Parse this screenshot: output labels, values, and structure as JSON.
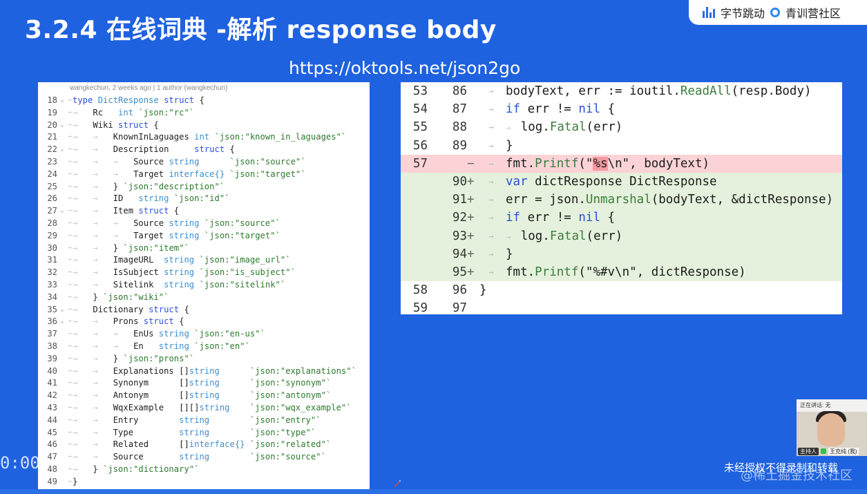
{
  "slide": {
    "title": "3.2.4 在线词典 -解析 response body",
    "url": "https://oktools.net/json2go"
  },
  "branding": {
    "logo1": "字节跳动",
    "logo2": "青训营社区"
  },
  "left_code": {
    "blame": "wangkechun, 2 weeks ago | 1 author (wangkechun)",
    "lines": [
      {
        "n": "18",
        "fold": "⌄",
        "indent": 0,
        "parts": [
          [
            "kw",
            "type "
          ],
          [
            "typ",
            "DictResponse "
          ],
          [
            "kw",
            "struct "
          ],
          [
            "",
            "{"
          ]
        ]
      },
      {
        "n": "19",
        "fold": "",
        "indent": 1,
        "parts": [
          [
            "",
            "Rc   "
          ],
          [
            "typ",
            "int "
          ],
          [
            "tag",
            "`json:\"rc\"`"
          ]
        ]
      },
      {
        "n": "20",
        "fold": "⌄",
        "indent": 1,
        "parts": [
          [
            "",
            "Wiki "
          ],
          [
            "kw",
            "struct "
          ],
          [
            "",
            "{"
          ]
        ]
      },
      {
        "n": "21",
        "fold": "",
        "indent": 2,
        "parts": [
          [
            "",
            "KnownInLaguages "
          ],
          [
            "typ",
            "int "
          ],
          [
            "tag",
            "`json:\"known_in_laguages\"`"
          ]
        ]
      },
      {
        "n": "22",
        "fold": "⌄",
        "indent": 2,
        "parts": [
          [
            "",
            "Description     "
          ],
          [
            "kw",
            "struct "
          ],
          [
            "",
            "{"
          ]
        ]
      },
      {
        "n": "23",
        "fold": "",
        "indent": 3,
        "parts": [
          [
            "",
            "Source "
          ],
          [
            "typ",
            "string      "
          ],
          [
            "tag",
            "`json:\"source\"`"
          ]
        ]
      },
      {
        "n": "24",
        "fold": "",
        "indent": 3,
        "parts": [
          [
            "",
            "Target "
          ],
          [
            "typ",
            "interface{} "
          ],
          [
            "tag",
            "`json:\"target\"`"
          ]
        ]
      },
      {
        "n": "25",
        "fold": "",
        "indent": 2,
        "parts": [
          [
            "",
            "} "
          ],
          [
            "tag",
            "`json:\"description\"`"
          ]
        ]
      },
      {
        "n": "26",
        "fold": "",
        "indent": 2,
        "parts": [
          [
            "",
            "ID   "
          ],
          [
            "typ",
            "string "
          ],
          [
            "tag",
            "`json:\"id\"`"
          ]
        ]
      },
      {
        "n": "27",
        "fold": "⌄",
        "indent": 2,
        "parts": [
          [
            "",
            "Item "
          ],
          [
            "kw",
            "struct "
          ],
          [
            "",
            "{"
          ]
        ]
      },
      {
        "n": "28",
        "fold": "",
        "indent": 3,
        "parts": [
          [
            "",
            "Source "
          ],
          [
            "typ",
            "string "
          ],
          [
            "tag",
            "`json:\"source\"`"
          ]
        ]
      },
      {
        "n": "29",
        "fold": "",
        "indent": 3,
        "parts": [
          [
            "",
            "Target "
          ],
          [
            "typ",
            "string "
          ],
          [
            "tag",
            "`json:\"target\"`"
          ]
        ]
      },
      {
        "n": "30",
        "fold": "",
        "indent": 2,
        "parts": [
          [
            "",
            "} "
          ],
          [
            "tag",
            "`json:\"item\"`"
          ]
        ]
      },
      {
        "n": "31",
        "fold": "",
        "indent": 2,
        "parts": [
          [
            "",
            "ImageURL  "
          ],
          [
            "typ",
            "string "
          ],
          [
            "tag",
            "`json:\"image_url\"`"
          ]
        ]
      },
      {
        "n": "32",
        "fold": "",
        "indent": 2,
        "parts": [
          [
            "",
            "IsSubject "
          ],
          [
            "typ",
            "string "
          ],
          [
            "tag",
            "`json:\"is_subject\"`"
          ]
        ]
      },
      {
        "n": "33",
        "fold": "",
        "indent": 2,
        "parts": [
          [
            "",
            "Sitelink  "
          ],
          [
            "typ",
            "string "
          ],
          [
            "tag",
            "`json:\"sitelink\"`"
          ]
        ]
      },
      {
        "n": "34",
        "fold": "",
        "indent": 1,
        "parts": [
          [
            "",
            "} "
          ],
          [
            "tag",
            "`json:\"wiki\"`"
          ]
        ]
      },
      {
        "n": "35",
        "fold": "⌄",
        "indent": 1,
        "parts": [
          [
            "",
            "Dictionary "
          ],
          [
            "kw",
            "struct "
          ],
          [
            "",
            "{"
          ]
        ]
      },
      {
        "n": "36",
        "fold": "⌄",
        "indent": 2,
        "parts": [
          [
            "",
            "Prons "
          ],
          [
            "kw",
            "struct "
          ],
          [
            "",
            "{"
          ]
        ]
      },
      {
        "n": "37",
        "fold": "",
        "indent": 3,
        "parts": [
          [
            "",
            "EnUs "
          ],
          [
            "typ",
            "string "
          ],
          [
            "tag",
            "`json:\"en-us\"`"
          ]
        ]
      },
      {
        "n": "38",
        "fold": "",
        "indent": 3,
        "parts": [
          [
            "",
            "En   "
          ],
          [
            "typ",
            "string "
          ],
          [
            "tag",
            "`json:\"en\"`"
          ]
        ]
      },
      {
        "n": "39",
        "fold": "",
        "indent": 2,
        "parts": [
          [
            "",
            "} "
          ],
          [
            "tag",
            "`json:\"prons\"`"
          ]
        ]
      },
      {
        "n": "40",
        "fold": "",
        "indent": 2,
        "parts": [
          [
            "",
            "Explanations "
          ],
          [
            "",
            "[]"
          ],
          [
            "typ",
            "string      "
          ],
          [
            "tag",
            "`json:\"explanations\"`"
          ]
        ]
      },
      {
        "n": "41",
        "fold": "",
        "indent": 2,
        "parts": [
          [
            "",
            "Synonym      "
          ],
          [
            "",
            "[]"
          ],
          [
            "typ",
            "string      "
          ],
          [
            "tag",
            "`json:\"synonym\"`"
          ]
        ]
      },
      {
        "n": "42",
        "fold": "",
        "indent": 2,
        "parts": [
          [
            "",
            "Antonym      "
          ],
          [
            "",
            "[]"
          ],
          [
            "typ",
            "string      "
          ],
          [
            "tag",
            "`json:\"antonym\"`"
          ]
        ]
      },
      {
        "n": "43",
        "fold": "",
        "indent": 2,
        "parts": [
          [
            "",
            "WqxExample   "
          ],
          [
            "",
            "[][]"
          ],
          [
            "typ",
            "string    "
          ],
          [
            "tag",
            "`json:\"wqx_example\"`"
          ]
        ]
      },
      {
        "n": "44",
        "fold": "",
        "indent": 2,
        "parts": [
          [
            "",
            "Entry        "
          ],
          [
            "typ",
            "string        "
          ],
          [
            "tag",
            "`json:\"entry\"`"
          ]
        ]
      },
      {
        "n": "45",
        "fold": "",
        "indent": 2,
        "parts": [
          [
            "",
            "Type         "
          ],
          [
            "typ",
            "string        "
          ],
          [
            "tag",
            "`json:\"type\"`"
          ]
        ]
      },
      {
        "n": "46",
        "fold": "",
        "indent": 2,
        "parts": [
          [
            "",
            "Related      "
          ],
          [
            "",
            "[]"
          ],
          [
            "typ",
            "interface{} "
          ],
          [
            "tag",
            "`json:\"related\"`"
          ]
        ]
      },
      {
        "n": "47",
        "fold": "",
        "indent": 2,
        "parts": [
          [
            "",
            "Source       "
          ],
          [
            "typ",
            "string        "
          ],
          [
            "tag",
            "`json:\"source\"`"
          ]
        ]
      },
      {
        "n": "48",
        "fold": "",
        "indent": 1,
        "parts": [
          [
            "",
            "} "
          ],
          [
            "tag",
            "`json:\"dictionary\"`"
          ]
        ]
      },
      {
        "n": "49",
        "fold": "",
        "indent": 0,
        "parts": [
          [
            "",
            "}"
          ]
        ]
      }
    ]
  },
  "right_code": {
    "lines": [
      {
        "o": "53",
        "n": "86",
        "sign": "",
        "type": "",
        "indent": 0,
        "parts": [
          [
            "",
            "bodyText, err := ioutil."
          ],
          [
            "fn",
            "ReadAll"
          ],
          [
            "",
            "(resp.Body)"
          ]
        ]
      },
      {
        "o": "54",
        "n": "87",
        "sign": "",
        "type": "",
        "indent": 0,
        "parts": [
          [
            "rkw",
            "if "
          ],
          [
            "",
            "err != "
          ],
          [
            "rkw",
            "nil "
          ],
          [
            "",
            "{"
          ]
        ]
      },
      {
        "o": "55",
        "n": "88",
        "sign": "",
        "type": "",
        "indent": 1,
        "parts": [
          [
            "",
            "log."
          ],
          [
            "fn",
            "Fatal"
          ],
          [
            "",
            "(err)"
          ]
        ]
      },
      {
        "o": "56",
        "n": "89",
        "sign": "",
        "type": "",
        "indent": 0,
        "parts": [
          [
            "",
            "}"
          ]
        ]
      },
      {
        "o": "57",
        "n": "",
        "sign": "−",
        "type": "del",
        "indent": 0,
        "parts": [
          [
            "",
            "fmt."
          ],
          [
            "fn",
            "Printf"
          ],
          [
            "",
            "(\""
          ],
          [
            "strhl",
            "%s"
          ],
          [
            "",
            "\\n\", bodyText)"
          ]
        ]
      },
      {
        "o": "",
        "n": "90",
        "sign": "+",
        "type": "add",
        "indent": 0,
        "parts": [
          [
            "rkw",
            "var "
          ],
          [
            "",
            "dictResponse DictResponse"
          ]
        ]
      },
      {
        "o": "",
        "n": "91",
        "sign": "+",
        "type": "add",
        "indent": 0,
        "parts": [
          [
            "",
            "err = json."
          ],
          [
            "fn",
            "Unmarshal"
          ],
          [
            "",
            "(bodyText, &dictResponse)"
          ]
        ]
      },
      {
        "o": "",
        "n": "92",
        "sign": "+",
        "type": "add",
        "indent": 0,
        "parts": [
          [
            "rkw",
            "if "
          ],
          [
            "",
            "err != "
          ],
          [
            "rkw",
            "nil "
          ],
          [
            "",
            "{"
          ]
        ]
      },
      {
        "o": "",
        "n": "93",
        "sign": "+",
        "type": "add",
        "indent": 1,
        "parts": [
          [
            "",
            "log."
          ],
          [
            "fn",
            "Fatal"
          ],
          [
            "",
            "(err)"
          ]
        ]
      },
      {
        "o": "",
        "n": "94",
        "sign": "+",
        "type": "add",
        "indent": 0,
        "parts": [
          [
            "",
            "}"
          ]
        ]
      },
      {
        "o": "",
        "n": "95",
        "sign": "+",
        "type": "add",
        "indent": 0,
        "parts": [
          [
            "",
            "fmt."
          ],
          [
            "fn",
            "Printf"
          ],
          [
            "",
            "(\"%#v\\n\", dictResponse)"
          ]
        ]
      },
      {
        "o": "58",
        "n": "96",
        "sign": "",
        "type": "",
        "indent": -1,
        "parts": [
          [
            "",
            "}"
          ]
        ]
      },
      {
        "o": "59",
        "n": "97",
        "sign": "",
        "type": "",
        "indent": -1,
        "parts": [
          [
            "",
            ""
          ]
        ]
      }
    ]
  },
  "video": {
    "top_label": "正在讲话: 无",
    "host_tag": "主持人",
    "host_name": "王克纯 (我)"
  },
  "overlay": {
    "rights": "未经授权不得录制和转载",
    "footer_watermark": "@稀土掘金技术社区",
    "time": "0:00"
  },
  "colors": {
    "background": "#1f62e0",
    "diff_del": "#fbd3d6",
    "diff_add": "#e5f1dc",
    "keyword": "#2b4fd8"
  }
}
